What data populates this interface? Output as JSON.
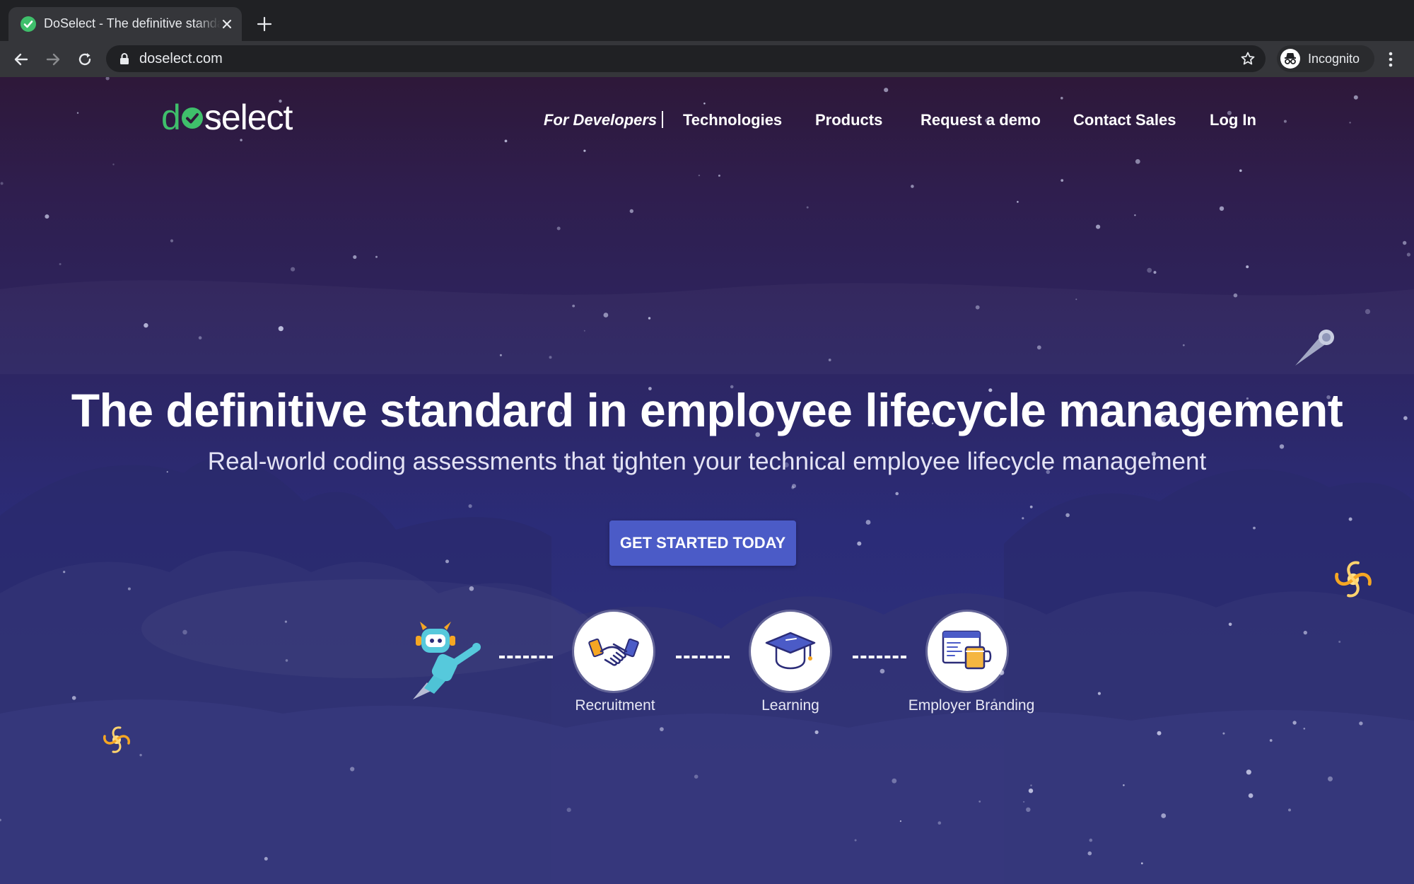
{
  "browser": {
    "tab_title": "DoSelect - The definitive standard in employee lifecycle management",
    "url": "doselect.com",
    "profile_label": "Incognito",
    "favicon_color": "#3fbf6b"
  },
  "site": {
    "logo": {
      "first": "d",
      "rest": "select"
    },
    "nav": {
      "for_developers": "For Developers",
      "technologies": "Technologies",
      "products": "Products",
      "request_demo": "Request a demo",
      "contact_sales": "Contact Sales",
      "log_in": "Log In"
    },
    "hero": {
      "title": "The definitive standard in employee lifecycle management",
      "subtitle": "Real-world coding assessments that tighten your technical employee lifecycle management",
      "cta": "GET STARTED TODAY"
    },
    "stages": [
      {
        "label": "Recruitment",
        "icon": "handshake-icon"
      },
      {
        "label": "Learning",
        "icon": "graduation-cap-icon"
      },
      {
        "label": "Employer Branding",
        "icon": "browser-mug-icon"
      }
    ]
  },
  "colors": {
    "brand_green": "#3fbf6b",
    "cta_blue": "#4b5bc7",
    "text_white": "#ffffff"
  }
}
